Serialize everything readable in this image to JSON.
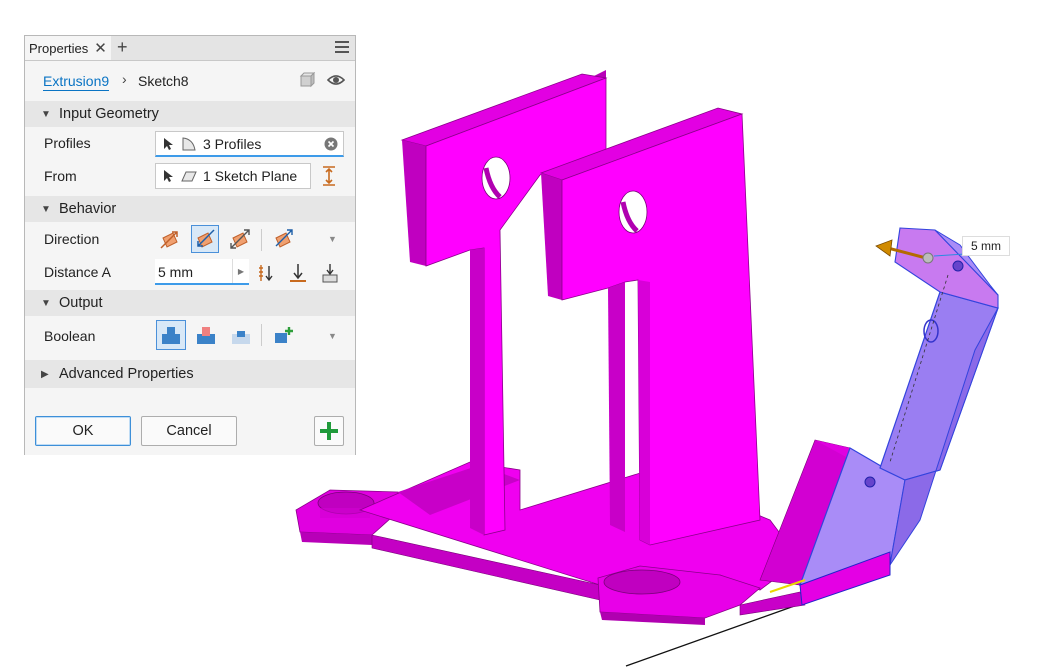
{
  "panel": {
    "tab_title": "Properties",
    "tab_close": "✕",
    "tab_add": "+",
    "breadcrumb": {
      "feature": "Extrusion9",
      "separator": "›",
      "sketch": "Sketch8"
    },
    "sections": {
      "input_geometry": "Input Geometry",
      "behavior": "Behavior",
      "output": "Output",
      "advanced": "Advanced Properties"
    },
    "profiles": {
      "label": "Profiles",
      "value": "3 Profiles"
    },
    "from": {
      "label": "From",
      "value": "1 Sketch Plane"
    },
    "direction": {
      "label": "Direction",
      "selected_index": 1
    },
    "distance_a": {
      "label": "Distance A",
      "value": "5 mm"
    },
    "boolean": {
      "label": "Boolean",
      "selected_index": 0
    },
    "buttons": {
      "ok": "OK",
      "cancel": "Cancel",
      "apply": "+"
    }
  },
  "viewport": {
    "dimension_label": "5 mm",
    "model_color": "#ff00ff",
    "preview_color": "#a98cf7"
  }
}
